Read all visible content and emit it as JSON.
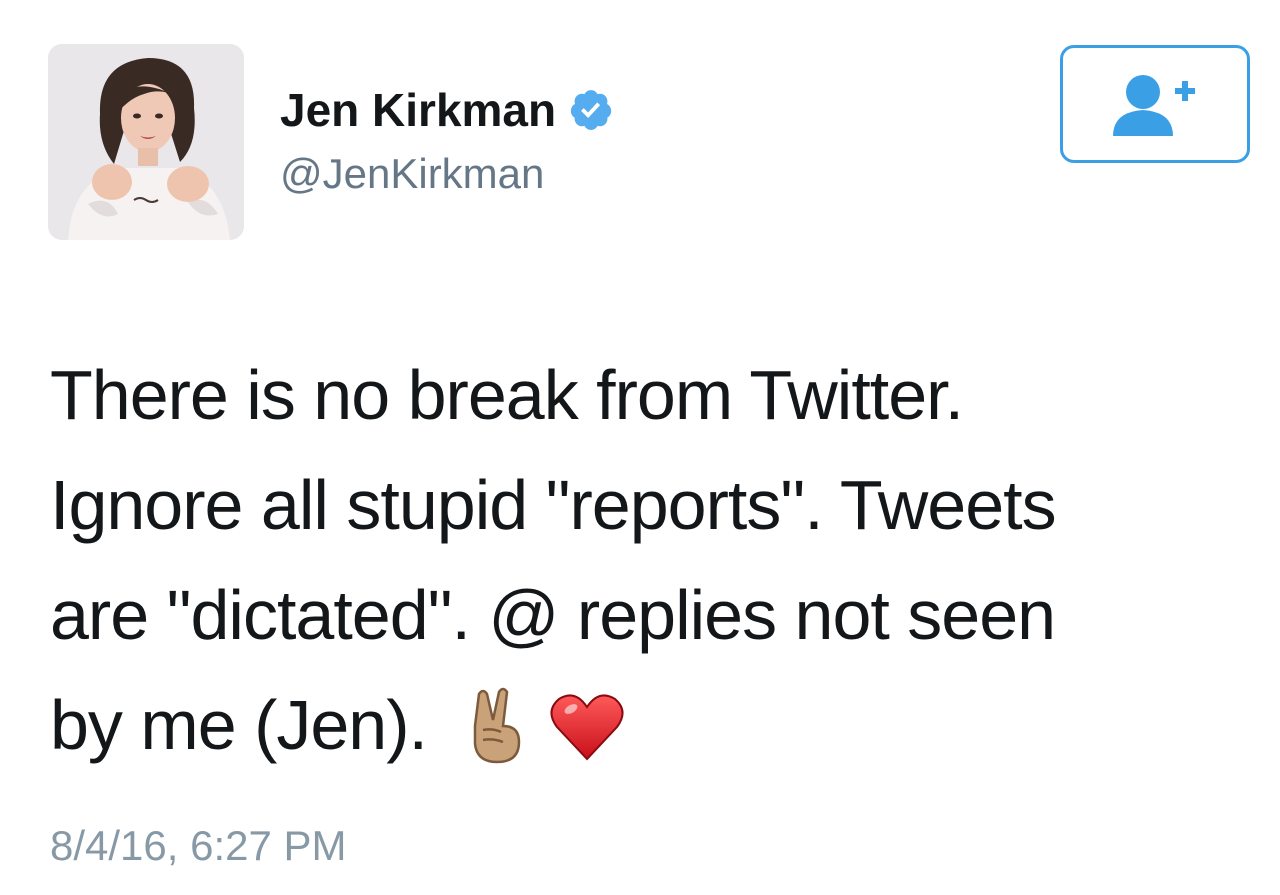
{
  "author": {
    "display_name": "Jen Kirkman",
    "handle": "@JenKirkman",
    "verified": true,
    "avatar_icon": "avatar-photo"
  },
  "follow_button": {
    "icon": "follow-user-plus-icon",
    "color": "#3b9fe6"
  },
  "tweet": {
    "lines": [
      "There is no break from Twitter.",
      "Ignore all stupid \"reports\". Tweets",
      "are \"dictated\". @ replies not seen",
      "by me (Jen)."
    ],
    "emojis": [
      "victory-hand-icon",
      "red-heart-icon"
    ],
    "timestamp": "8/4/16, 6:27 PM"
  },
  "colors": {
    "text": "#14171a",
    "handle": "#657786",
    "timestamp": "#8899a6",
    "accent": "#3b9fe6",
    "verified": "#55acee"
  }
}
